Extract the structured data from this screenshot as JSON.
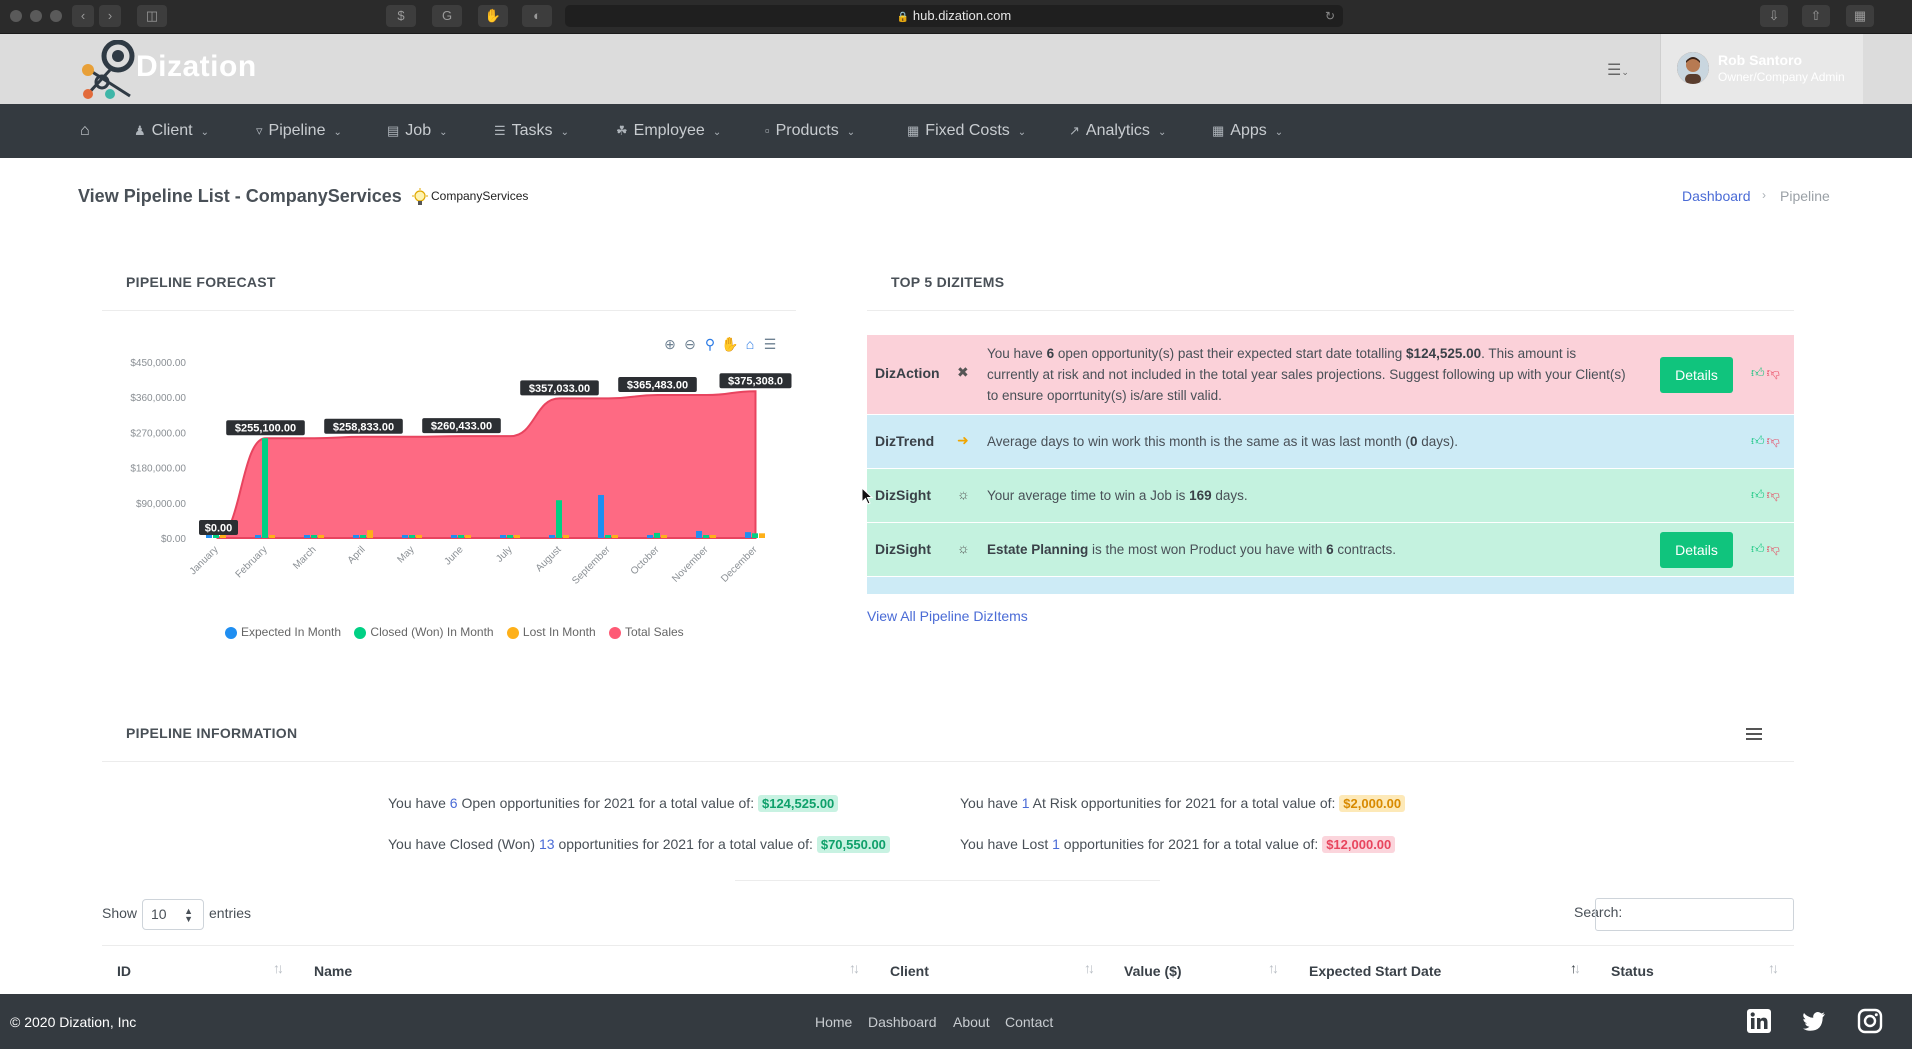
{
  "browser": {
    "url": "hub.dization.com"
  },
  "app": {
    "brand": "Dization"
  },
  "user": {
    "name": "Rob Santoro",
    "role": "Owner/Company Admin"
  },
  "nav": {
    "items": [
      {
        "label": "Client",
        "icon": "user-icon"
      },
      {
        "label": "Pipeline",
        "icon": "funnel-icon"
      },
      {
        "label": "Job",
        "icon": "calendar-icon"
      },
      {
        "label": "Tasks",
        "icon": "list-icon"
      },
      {
        "label": "Employee",
        "icon": "sitemap-icon"
      },
      {
        "label": "Products",
        "icon": "box-icon"
      },
      {
        "label": "Fixed Costs",
        "icon": "receipt-icon"
      },
      {
        "label": "Analytics",
        "icon": "line-chart-icon"
      },
      {
        "label": "Apps",
        "icon": "grid-icon"
      }
    ]
  },
  "page": {
    "title": "View Pipeline List - CompanyServices",
    "company": "CompanyServices",
    "breadcrumb": {
      "home": "Dashboard",
      "current": "Pipeline"
    }
  },
  "forecast": {
    "title": "PIPELINE FORECAST",
    "legend": {
      "expected": "Expected In Month",
      "closed": "Closed (Won) In Month",
      "lost": "Lost In Month",
      "total": "Total Sales"
    }
  },
  "chart_data": {
    "type": "area",
    "categories": [
      "January",
      "February",
      "March",
      "April",
      "May",
      "June",
      "July",
      "August",
      "September",
      "October",
      "November",
      "December"
    ],
    "ylim": [
      0,
      450000
    ],
    "yticks": [
      "$0.00",
      "$90,000.00",
      "$180,000.00",
      "$270,000.00",
      "$360,000.00",
      "$450,000.00"
    ],
    "series": [
      {
        "name": "Total Sales",
        "type": "area",
        "color": "#fe5a75",
        "values": [
          0,
          255100,
          255100,
          258833,
          258833,
          260433,
          260433,
          357033,
          357033,
          365483,
          365483,
          375308
        ]
      },
      {
        "name": "Expected In Month",
        "type": "bar",
        "color": "#1f8ef1",
        "values": [
          0,
          4000,
          4000,
          6000,
          3000,
          4000,
          3000,
          4000,
          110000,
          4000,
          18000,
          15000
        ]
      },
      {
        "name": "Closed (Won) In Month",
        "type": "bar",
        "color": "#00d084",
        "values": [
          0,
          255100,
          2000,
          6000,
          3000,
          6000,
          3000,
          96600,
          2000,
          13000,
          5000,
          12000
        ]
      },
      {
        "name": "Lost In Month",
        "type": "bar",
        "color": "#feb019",
        "values": [
          0,
          2000,
          2000,
          20000,
          2000,
          2000,
          2000,
          2000,
          2000,
          4000,
          2000,
          12000
        ]
      }
    ],
    "data_labels": [
      "$0.00",
      "$255,100.00",
      "$258,833.00",
      "$260,433.00",
      "$357,033.00",
      "$365,483.00",
      "$375,308.0"
    ],
    "data_label_index": [
      0,
      1,
      3,
      5,
      7,
      9,
      11
    ],
    "legend_position": "bottom"
  },
  "dizitems": {
    "title": "TOP 5 DIZITEMS",
    "rows": [
      {
        "name": "DizAction",
        "color": "#fbd1d9",
        "text_1": "You have ",
        "b1": "6",
        "text_2": " open opportunity(s) past their expected start date totalling ",
        "b2": "$124,525.00",
        "text_3": ". This amount is currently at risk and not included in the total year sales projections. Suggest following up with your Client(s) to ensure oporrtunity(s) is/are still valid.",
        "details": "Details"
      },
      {
        "name": "DizTrend",
        "color": "#cdebf6",
        "text_1": "Average days to win work this month is the same as it was last month (",
        "b1": "0",
        "text_2": " days)."
      },
      {
        "name": "DizSight",
        "color": "#c4f2df",
        "text_1": "Your average time to win a Job is ",
        "b1": "169",
        "text_2": " days."
      },
      {
        "name": "DizSight",
        "color": "#c4f2df",
        "b0": "Estate Planning",
        "text_1": " is the most won Product you have with ",
        "b1": "6",
        "text_2": " contracts.",
        "details": "Details"
      }
    ],
    "view_all": "View All Pipeline DizItems"
  },
  "info": {
    "title": "PIPELINE INFORMATION",
    "open": {
      "pre": "You have ",
      "count": "6",
      "post": " Open opportunities for 2021 for a total value of:",
      "value": "$124,525.00"
    },
    "risk": {
      "pre": "You have ",
      "count": "1",
      "post": " At Risk opportunities for 2021 for a total value of:",
      "value": "$2,000.00"
    },
    "won": {
      "pre": "You have Closed (Won) ",
      "count": "13",
      "post": " opportunities for 2021 for a total value of:",
      "value": "$70,550.00"
    },
    "lost": {
      "pre": "You have Lost ",
      "count": "1",
      "post": " opportunities for 2021 for a total value of:",
      "value": "$12,000.00"
    }
  },
  "table": {
    "show_label": "Show",
    "page_size": "10",
    "entries_label": "entries",
    "search_label": "Search:",
    "columns": [
      "ID",
      "Name",
      "Client",
      "Value ($)",
      "Expected Start Date",
      "Status"
    ]
  },
  "footer": {
    "copyright": "© 2020 Dization, Inc",
    "links": [
      "Home",
      "Dashboard",
      "About",
      "Contact"
    ]
  }
}
